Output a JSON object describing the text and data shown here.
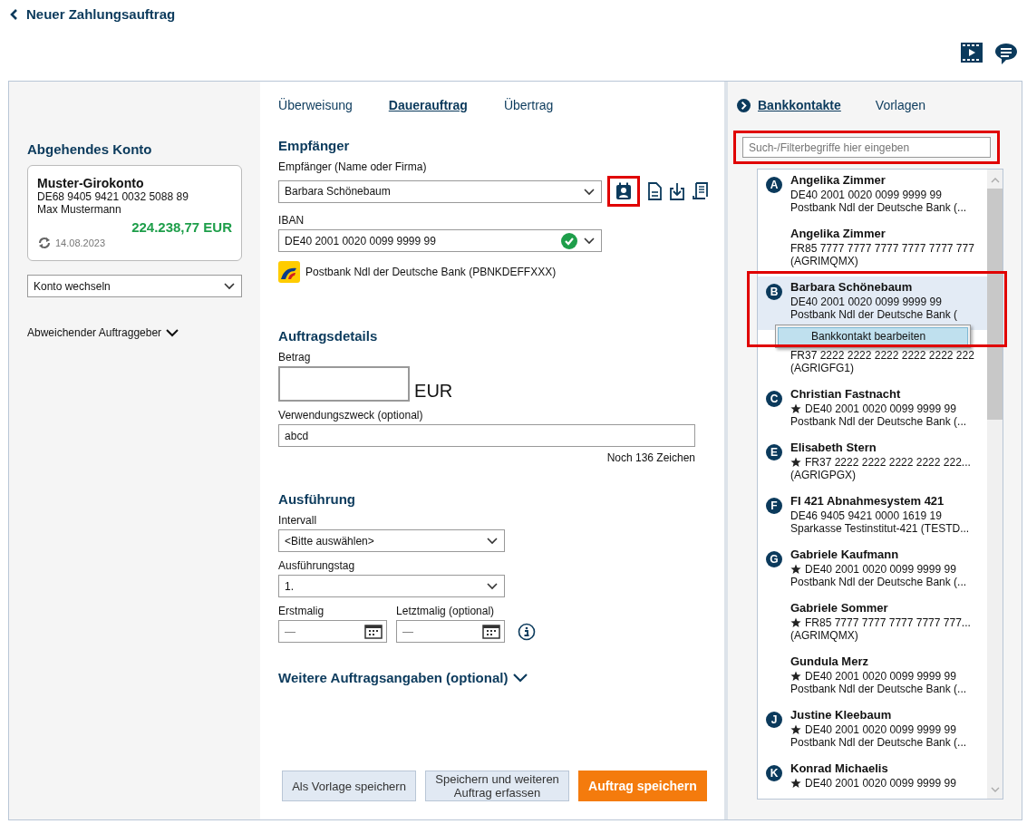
{
  "header": {
    "title": "Neuer Zahlungsauftrag"
  },
  "left": {
    "heading": "Abgehendes Konto",
    "account": {
      "name": "Muster-Girokonto",
      "iban": "DE68 9405 9421 0032 5088 89",
      "owner": "Max Mustermann",
      "balance": "224.238,77 EUR",
      "date": "14.08.2023"
    },
    "switch_select": {
      "value": "Konto wechseln"
    },
    "other_payer": {
      "label": "Abweichender Auftraggeber",
      "expanded": false
    }
  },
  "tabs": [
    {
      "label": "Überweisung",
      "selected": false
    },
    {
      "label": "Dauerauftrag",
      "selected": true
    },
    {
      "label": "Übertrag",
      "selected": false
    }
  ],
  "recipient": {
    "heading": "Empfänger",
    "name_label": "Empfänger (Name oder Firma)",
    "name_value": "Barbara Schönebaum",
    "contacts_button_highlighted": true,
    "iban_label": "IBAN",
    "iban_value": "DE40 2001 0020 0099 9999 99",
    "iban_valid": true,
    "bank": "Postbank Ndl der Deutsche Bank",
    "bic": "(PBNKDEFFXXX)"
  },
  "details": {
    "heading": "Auftragsdetails",
    "amount_label": "Betrag",
    "currency": "EUR",
    "purpose_label": "Verwendungszweck (optional)",
    "purpose_value": "abcd",
    "remaining": "Noch 136 Zeichen"
  },
  "execution": {
    "heading": "Ausführung",
    "interval_label": "Intervall",
    "interval_value": "<Bitte auswählen>",
    "day_label": "Ausführungstag",
    "day_value": "1.",
    "first_label": "Erstmalig",
    "first_placeholder": "—",
    "last_label": "Letztmalig (optional)",
    "last_placeholder": "—"
  },
  "more": {
    "label": "Weitere Auftragsangaben (optional)",
    "expanded": false
  },
  "buttons": [
    {
      "label": "Als Vorlage speichern",
      "kind": "secondary"
    },
    {
      "label": "Speichern und weiteren Auftrag erfassen",
      "kind": "secondary"
    },
    {
      "label": "Auftrag speichern",
      "kind": "primary"
    }
  ],
  "side_tabs": [
    {
      "label": "Bankkontakte",
      "selected": true
    },
    {
      "label": "Vorlagen",
      "selected": false
    }
  ],
  "search": {
    "placeholder": "Such-/Filterbegriffe hier eingeben",
    "highlighted": true
  },
  "contacts": [
    {
      "letter": "A",
      "name": "Angelika Zimmer",
      "starred": false,
      "iban": "DE40 2001 0020 0099 9999 99",
      "bank": "Postbank Ndl der Deutsche Bank (...",
      "selected": false
    },
    {
      "name": "Angelika Zimmer",
      "starred": false,
      "iban": "FR85 7777 7777 7777 7777 7777 777",
      "bank": "(AGRIMQMX)",
      "selected": false
    },
    {
      "letter": "B",
      "name": "Barbara Schönebaum",
      "starred": false,
      "iban": "DE40 2001 0020 0099 9999 99",
      "bank": "Postbank Ndl der Deutsche Bank (",
      "selected": true
    },
    {
      "starred": false,
      "iban": "FR37 2222 2222 2222 2222 2222 222",
      "bank": "(AGRIGFG1)",
      "selected": false
    },
    {
      "letter": "C",
      "name": "Christian Fastnacht",
      "starred": true,
      "iban": "DE40 2001 0020 0099 9999 99",
      "bank": "Postbank Ndl der Deutsche Bank (...",
      "selected": false
    },
    {
      "letter": "E",
      "name": "Elisabeth Stern",
      "starred": true,
      "iban": "FR37 2222 2222 2222 2222 222...",
      "bank": "(AGRIGPGX)",
      "selected": false
    },
    {
      "letter": "F",
      "name": "FI 421 Abnahmesystem 421",
      "starred": false,
      "iban": "DE46 9405 9421 0000 1619 19",
      "bank": "Sparkasse Testinstitut-421 (TESTD...",
      "selected": false
    },
    {
      "letter": "G",
      "name": "Gabriele Kaufmann",
      "starred": true,
      "iban": "DE40 2001 0020 0099 9999 99",
      "bank": "Postbank Ndl der Deutsche Bank (...",
      "selected": false
    },
    {
      "name": "Gabriele Sommer",
      "starred": true,
      "iban": "FR85 7777 7777 7777 7777 777...",
      "bank": "(AGRIMQMX)",
      "selected": false
    },
    {
      "name": "Gundula Merz",
      "starred": true,
      "iban": "DE40 2001 0020 0099 9999 99",
      "bank": "Postbank Ndl der Deutsche Bank (...",
      "selected": false
    },
    {
      "letter": "J",
      "name": "Justine Kleebaum",
      "starred": true,
      "iban": "DE40 2001 0020 0099 9999 99",
      "bank": "Postbank Ndl der Deutsche Bank (...",
      "selected": false
    },
    {
      "letter": "K",
      "name": "Konrad Michaelis",
      "starred": true,
      "iban": "DE40 2001 0020 0099 9999 99",
      "selected": false
    }
  ],
  "context_menu": {
    "item": "Bankkontakt bearbeiten",
    "highlighted": true
  }
}
